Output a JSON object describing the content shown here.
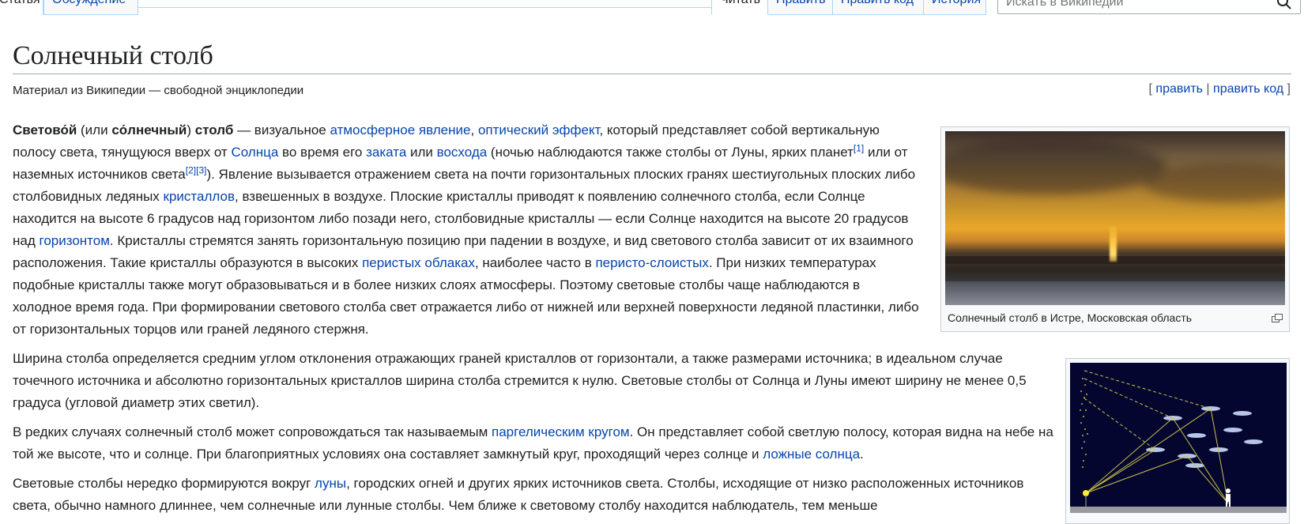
{
  "tabs": {
    "article": "Статья",
    "talk": "Обсуждение",
    "read": "Читать",
    "edit": "Править",
    "edit_source": "Править код",
    "history": "История"
  },
  "search": {
    "placeholder": "Искать в Википедии"
  },
  "header": {
    "title": "Солнечный столб",
    "subtitle": "Материал из Википедии — свободной энциклопедии",
    "edit_link": "править",
    "edit_source_link": "править код"
  },
  "article": {
    "p1": {
      "bold1": "Светово́й",
      "t1": " (или ",
      "bold2": "со́лнечный",
      "t2": ") ",
      "bold3": "столб",
      "t3": " — визуальное ",
      "link1": "атмосферное явление",
      "t4": ", ",
      "link2": "оптический эффект",
      "t5": ", который представляет собой вертикальную полосу света, тянущуюся вверх от ",
      "link3": "Солнца",
      "t6": " во время его ",
      "link4": "заката",
      "t7": " или ",
      "link5": "восхода",
      "t8": " (ночью наблюдаются также столбы от Луны, ярких планет",
      "ref1": "[1]",
      "t9": " или от наземных источников света",
      "ref2": "[2]",
      "ref3": "[3]",
      "t10": "). Явление вызывается отражением света на почти горизонтальных плоских гранях шестиугольных плоских либо столбовидных ледяных ",
      "link6": "кристаллов",
      "t11": ", взвешенных в воздухе. Плоские кристаллы приводят к появлению солнечного столба, если Солнце находится на высоте 6 градусов над горизонтом либо позади него, столбовидные кристаллы — если Солнце находится на высоте 20 градусов над ",
      "link7": "горизонтом",
      "t12": ". Кристаллы стремятся занять горизонтальную позицию при падении в воздухе, и вид светового столба зависит от их взаимного расположения. Такие кристаллы образуются в высоких ",
      "link8": "перистых облаках",
      "t13": ", наиболее часто в ",
      "link9": "перисто-слоистых",
      "t14": ". При низких температурах подобные кристаллы также могут образовываться и в более низких слоях атмосферы. Поэтому световые столбы чаще наблюдаются в холодное время года. При формировании светового столба свет отражается либо от нижней или верхней поверхности ледяной пластинки, либо от горизонтальных торцов или граней ледяного стержня."
    },
    "p2": "Ширина столба определяется средним углом отклонения отражающих граней кристаллов от горизонтали, а также размерами источника; в идеальном случае точечного источника и абсолютно горизонтальных кристаллов ширина столба стремится к нулю. Световые столбы от Солнца и Луны имеют ширину не менее 0,5 градуса (угловой диаметр этих светил).",
    "p3": {
      "t1": "В редких случаях солнечный столб может сопровождаться так называемым ",
      "link1": "паргелическим кругом",
      "t2": ". Он представляет собой светлую полосу, которая видна на небе на той же высоте, что и солнце. При благоприятных условиях она составляет замкнутый круг, проходящий через солнце и ",
      "link2": "ложные солнца",
      "t3": "."
    },
    "p4": {
      "t1": "Световые столбы нередко формируются вокруг ",
      "link1": "луны",
      "t2": ", городских огней и других ярких источников света. Столбы, исходящие от низко расположенных источников света, обычно намного длиннее, чем солнечные или лунные столбы. Чем ближе к световому столбу находится наблюдатель, тем меньше"
    }
  },
  "thumb1": {
    "caption": "Солнечный столб в Истре, Московская область"
  },
  "colors": {
    "link": "#0645ad",
    "text": "#202122",
    "border": "#a2a9b1",
    "tab_border": "#a7d7f9"
  }
}
